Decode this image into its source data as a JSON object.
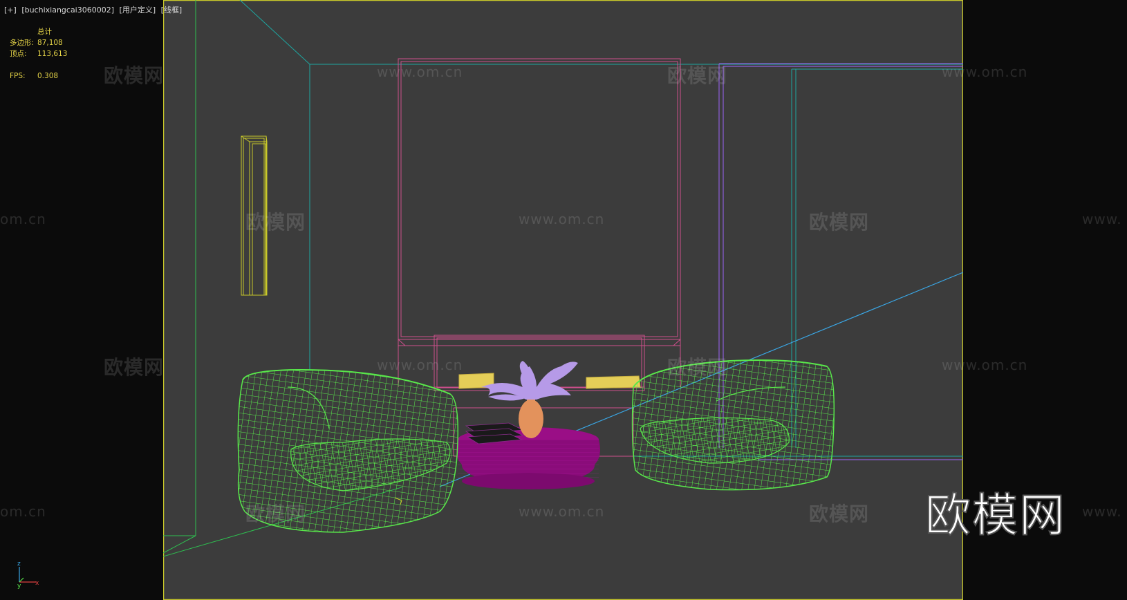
{
  "viewport_label": {
    "plus": "[+]",
    "camera": "[buchixiangcai3060002]",
    "view_mode": "[用户定义]",
    "shading": "[线框]"
  },
  "stats": {
    "header": "总计",
    "polygons_label": "多边形:",
    "polygons_value": "87,108",
    "vertices_label": "顶点:",
    "vertices_value": "113,613",
    "fps_label": "FPS:",
    "fps_value": "0.308"
  },
  "axis_gizmo": {
    "z": "z",
    "y": "y",
    "x": "x"
  },
  "watermark": {
    "cn": "欧模网",
    "url": "www.om.cn",
    "url_partial_left": "om.cn",
    "url_partial_right": "www."
  },
  "brand_logo": "欧模网",
  "colors": {
    "background": "#0b0b0b",
    "viewport_bg": "#3c3c3c",
    "viewport_border": "#c9c92a",
    "stats_text": "#e6d548",
    "armchair_wire": "#59e84b",
    "table": "#9a0e86",
    "vase": "#e3925c",
    "flowers": "#b69ae8",
    "pillows": "#e4ce58",
    "frame_pink": "#ce4f8c",
    "wall_teal": "#1ea6a0",
    "door_purple": "#8c5ed8",
    "ray_blue": "#3aa7e6",
    "lamp_yellow": "#c9c92a"
  }
}
